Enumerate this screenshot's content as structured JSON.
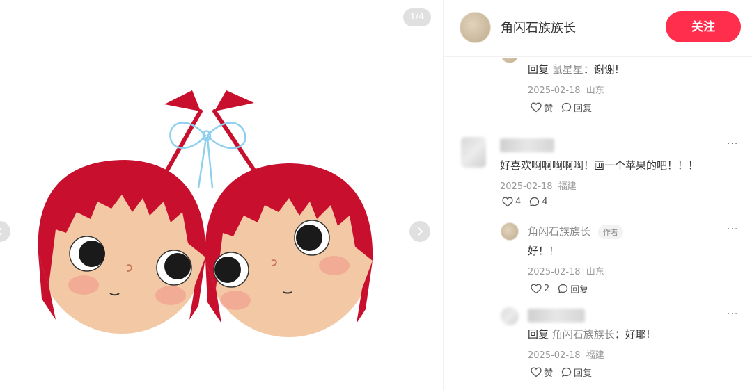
{
  "gallery": {
    "indicator": "1/4"
  },
  "author": {
    "name": "角闪石族族长",
    "follow_label": "关注"
  },
  "comments": [
    {
      "reply_prefix": "回复",
      "reply_target": "鼠星星",
      "text": "：谢谢!",
      "date": "2025-02-18",
      "location": "山东",
      "like_label": "赞",
      "reply_label": "回复"
    },
    {
      "text": "好喜欢啊啊啊啊啊！画一个苹果的吧！！！",
      "date": "2025-02-18",
      "location": "福建",
      "like_count": "4",
      "reply_count": "4",
      "more": "···"
    },
    {
      "name": "角闪石族族长",
      "author_tag": "作者",
      "text": "好！！",
      "date": "2025-02-18",
      "location": "山东",
      "like_count": "2",
      "reply_label": "回复",
      "more": "···"
    },
    {
      "reply_prefix": "回复",
      "reply_target": "角闪石族族长",
      "text": "：好耶!",
      "date": "2025-02-18",
      "location": "福建",
      "like_label": "赞",
      "reply_label": "回复",
      "more": "···"
    }
  ],
  "colors": {
    "follow_button": "#ff2e4d",
    "hair_red": "#c8102e",
    "ribbon_blue": "#8fd0ef",
    "skin": "#f3c9a5"
  },
  "icons": [
    "chevron-left-icon",
    "chevron-right-icon",
    "heart-icon",
    "comment-bubble-icon",
    "more-dots-icon"
  ]
}
